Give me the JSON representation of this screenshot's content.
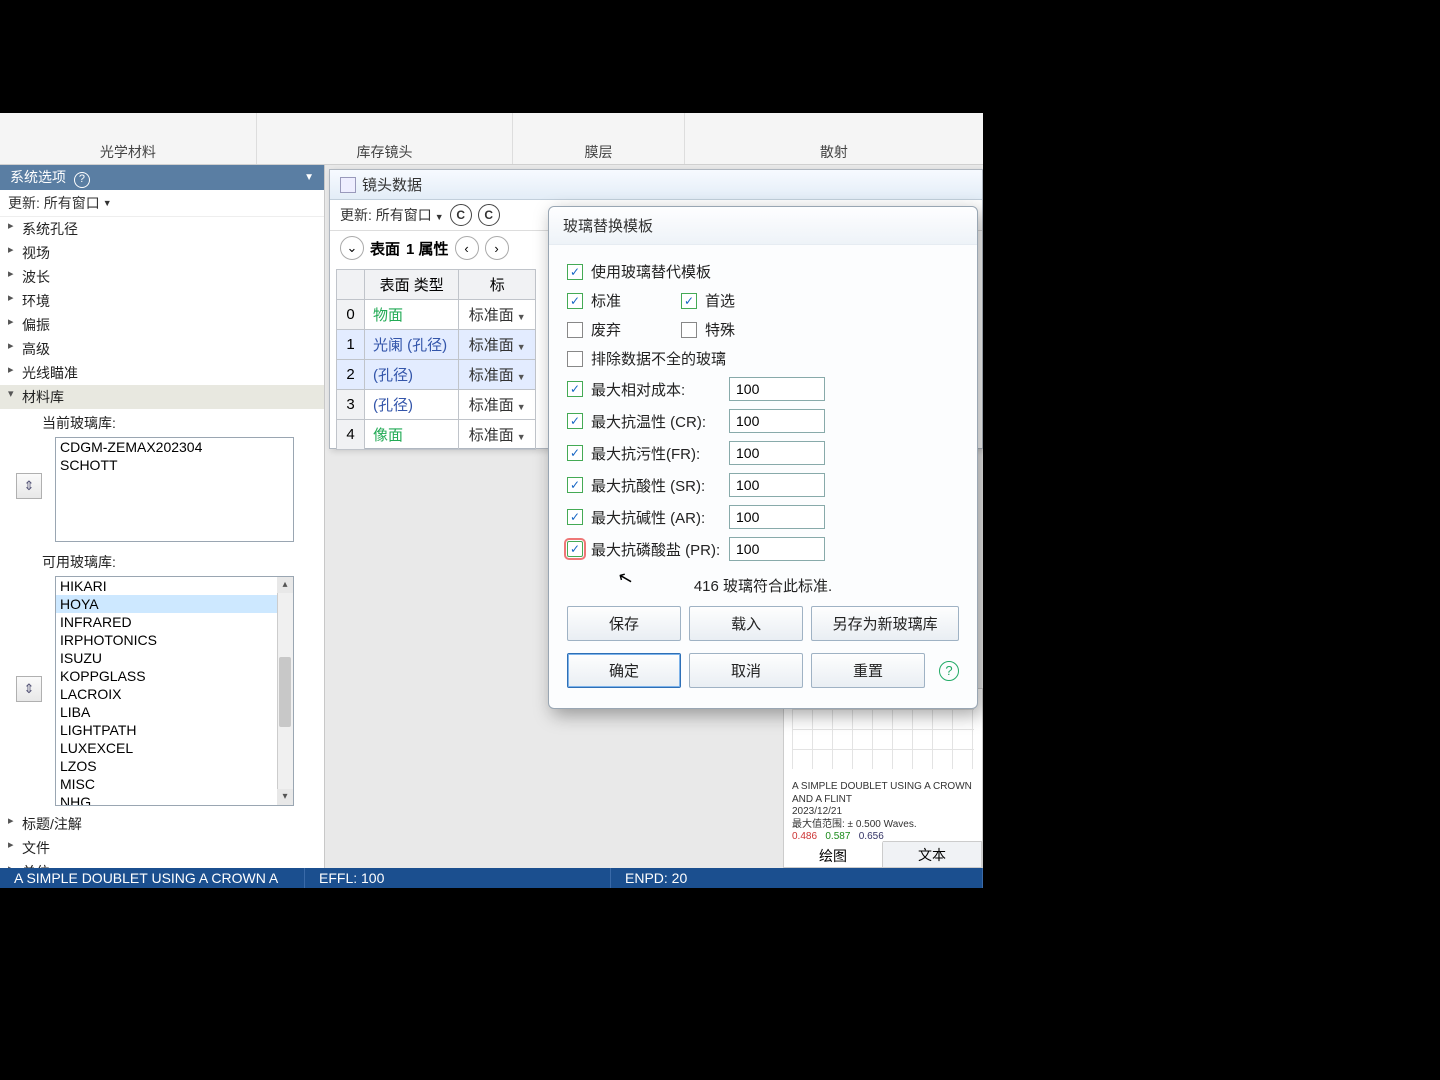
{
  "ribbon": {
    "g1": "光学材料",
    "g2": "库存镜头",
    "g3": "膜层",
    "g4": "散射"
  },
  "leftPanel": {
    "title": "系统选项",
    "update": "更新: 所有窗口",
    "tree": [
      "系统孔径",
      "视场",
      "波长",
      "环境",
      "偏振",
      "高级",
      "光线瞄准",
      "材料库"
    ],
    "currentLabel": "当前玻璃库:",
    "currentList": [
      "CDGM-ZEMAX202304",
      "SCHOTT"
    ],
    "availLabel": "可用玻璃库:",
    "availList": [
      "HIKARI",
      "HOYA",
      "INFRARED",
      "IRPHOTONICS",
      "ISUZU",
      "KOPPGLASS",
      "LACROIX",
      "LIBA",
      "LIGHTPATH",
      "LUXEXCEL",
      "LZOS",
      "MISC",
      "NHG"
    ],
    "availSelected": "HOYA",
    "treeBottom": [
      "标题/注解",
      "文件",
      "单位"
    ]
  },
  "lensWindow": {
    "title": "镜头数据",
    "update": "更新: 所有窗口",
    "surfaceRow": {
      "label": "表面",
      "prop": "1 属性"
    },
    "table": {
      "col1": "表面 类型",
      "col2": "标",
      "rows": [
        {
          "idx": "0",
          "name": "物面",
          "type": "标准面"
        },
        {
          "idx": "1",
          "name": "光阑  (孔径)",
          "type": "标准面",
          "hl": true,
          "blue": true
        },
        {
          "idx": "2",
          "name": "(孔径)",
          "type": "标准面",
          "hl": true,
          "blue": true
        },
        {
          "idx": "3",
          "name": "(孔径)",
          "type": "标准面",
          "blue": true
        },
        {
          "idx": "4",
          "name": "像面",
          "type": "标准面"
        }
      ]
    }
  },
  "dialog": {
    "title": "玻璃替换模板",
    "useTemplate": "使用玻璃替代模板",
    "standard": "标准",
    "preferred": "首选",
    "obsolete": "废弃",
    "special": "特殊",
    "excludeMissing": "排除数据不全的玻璃",
    "fields": [
      {
        "label": "最大相对成本:",
        "value": "100"
      },
      {
        "label": "最大抗温性 (CR):",
        "value": "100"
      },
      {
        "label": "最大抗污性(FR):",
        "value": "100"
      },
      {
        "label": "最大抗酸性 (SR):",
        "value": "100"
      },
      {
        "label": "最大抗碱性 (AR):",
        "value": "100"
      },
      {
        "label": "最大抗磷酸盐 (PR):",
        "value": "100"
      }
    ],
    "statusCount": "416 玻璃符合此标准.",
    "buttons": {
      "save": "保存",
      "load": "载入",
      "saveAs": "另存为新玻璃库",
      "ok": "确定",
      "cancel": "取消",
      "reset": "重置"
    }
  },
  "plot": {
    "line1": "A SIMPLE DOUBLET USING A CROWN AND A FLINT",
    "line2": "2023/12/21",
    "line3": "最大值范围: ± 0.500 Waves.",
    "v486": "0.486",
    "v587": "0.587",
    "v656": "0.656",
    "tabDraw": "绘图",
    "tabText": "文本"
  },
  "statusBar": {
    "title": "A SIMPLE DOUBLET USING A CROWN A",
    "effl": "EFFL: 100",
    "enpd": "ENPD: 20"
  }
}
